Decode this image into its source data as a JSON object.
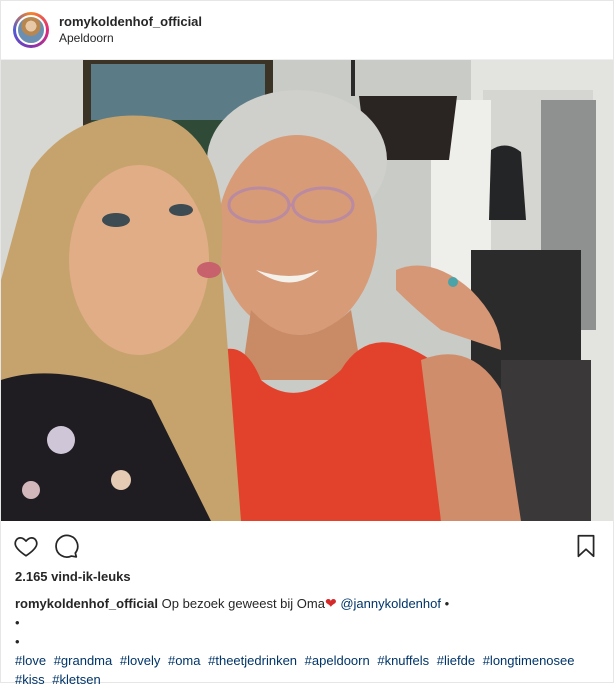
{
  "post": {
    "username": "romykoldenhof_official",
    "location": "Apeldoorn",
    "likes": "2.165 vind-ik-leuks",
    "caption": {
      "author": "romykoldenhof_official",
      "text": "Op bezoek geweest bij Oma",
      "emoji": "❤",
      "mention": "@jannykoldenhof",
      "trailing_dot": "•"
    },
    "dots": [
      "•",
      "•"
    ],
    "hashtags": [
      "#love",
      "#grandma",
      "#lovely",
      "#oma",
      "#theetjedrinken",
      "#apeldoorn",
      "#knuffels",
      "#liefde",
      "#longtimenosee",
      "#kiss",
      "#kletsen"
    ]
  },
  "icons": {
    "like": "heart-outline-icon",
    "comment": "speech-bubble-icon",
    "save": "bookmark-icon"
  },
  "colors": {
    "link": "#003569",
    "text": "#262626",
    "emoji_heart": "#d62a2a",
    "border": "#e6e6e6"
  }
}
